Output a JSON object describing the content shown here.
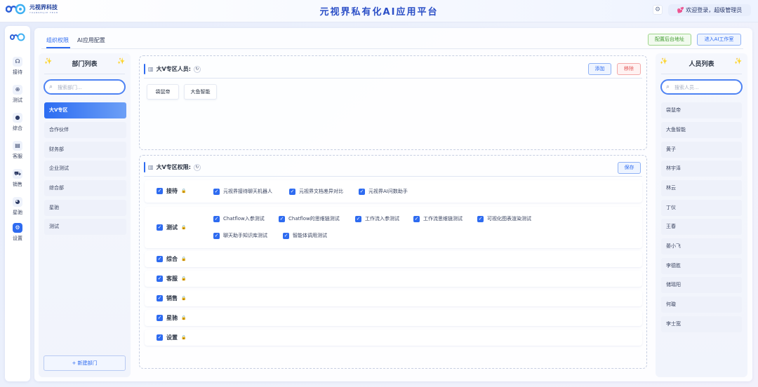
{
  "header": {
    "brand_cn": "元视界科技",
    "brand_en": "YUANSHIJIE TECH",
    "title": "元视界私有化AI应用平台",
    "welcome": "欢迎登录，超级管理员"
  },
  "rail": {
    "items": [
      {
        "label": "接待",
        "icon": "headset-icon"
      },
      {
        "label": "测试",
        "icon": "globe-icon"
      },
      {
        "label": "综合",
        "icon": "bell-icon"
      },
      {
        "label": "客服",
        "icon": "layers-icon"
      },
      {
        "label": "销售",
        "icon": "cart-icon"
      },
      {
        "label": "星驰",
        "icon": "planet-icon"
      },
      {
        "label": "设置",
        "icon": "gear-icon"
      }
    ],
    "active": "设置"
  },
  "tabs": [
    {
      "label": "组织权限",
      "active": true
    },
    {
      "label": "AI应用配置",
      "active": false
    }
  ],
  "top_actions": {
    "config_backend": "配置后台地址",
    "enter_studio": "进入AI工作室"
  },
  "dept_panel": {
    "title": "部门列表",
    "search_placeholder": "搜索部门...",
    "items": [
      "大V专区",
      "合作伙伴",
      "财务部",
      "企业测试",
      "综合部",
      "星驰",
      "测试"
    ],
    "selected": "大V专区",
    "new_button": "+ 新建部门"
  },
  "members_section": {
    "title": "大V专区人员:",
    "add": "添加",
    "remove": "移除",
    "members": [
      "袋鼠帝",
      "大鱼智能"
    ]
  },
  "permissions_section": {
    "title": "大V专区权限:",
    "save": "保存",
    "modules": [
      {
        "name": "接待",
        "options": [
          "元视界接待聊天机器人",
          "元视界文档差异对比",
          "元视界AI问数助手"
        ]
      },
      {
        "name": "测试",
        "options": [
          "Chatflow入参测试",
          "Chatflow的思维链测试",
          "工作流入参测试",
          "工作流思维链测试",
          "可视化图表渲染测试",
          "聊天助手知识库测试",
          "智能体调用测试"
        ]
      },
      {
        "name": "综合",
        "options": []
      },
      {
        "name": "客服",
        "options": []
      },
      {
        "name": "销售",
        "options": []
      },
      {
        "name": "星驰",
        "options": []
      },
      {
        "name": "设置",
        "options": []
      }
    ]
  },
  "people_panel": {
    "title": "人员列表",
    "search_placeholder": "搜索人员...",
    "items": [
      "袋鼠帝",
      "大鱼智能",
      "黄子",
      "林宇泽",
      "林云",
      "丁仪",
      "王春",
      "晏小飞",
      "李德胜",
      "储瑶阳",
      "何璇",
      "李士宽"
    ]
  },
  "colors": {
    "accent": "#2e6bf0",
    "green": "#3f9a2d",
    "red": "#e25555"
  }
}
